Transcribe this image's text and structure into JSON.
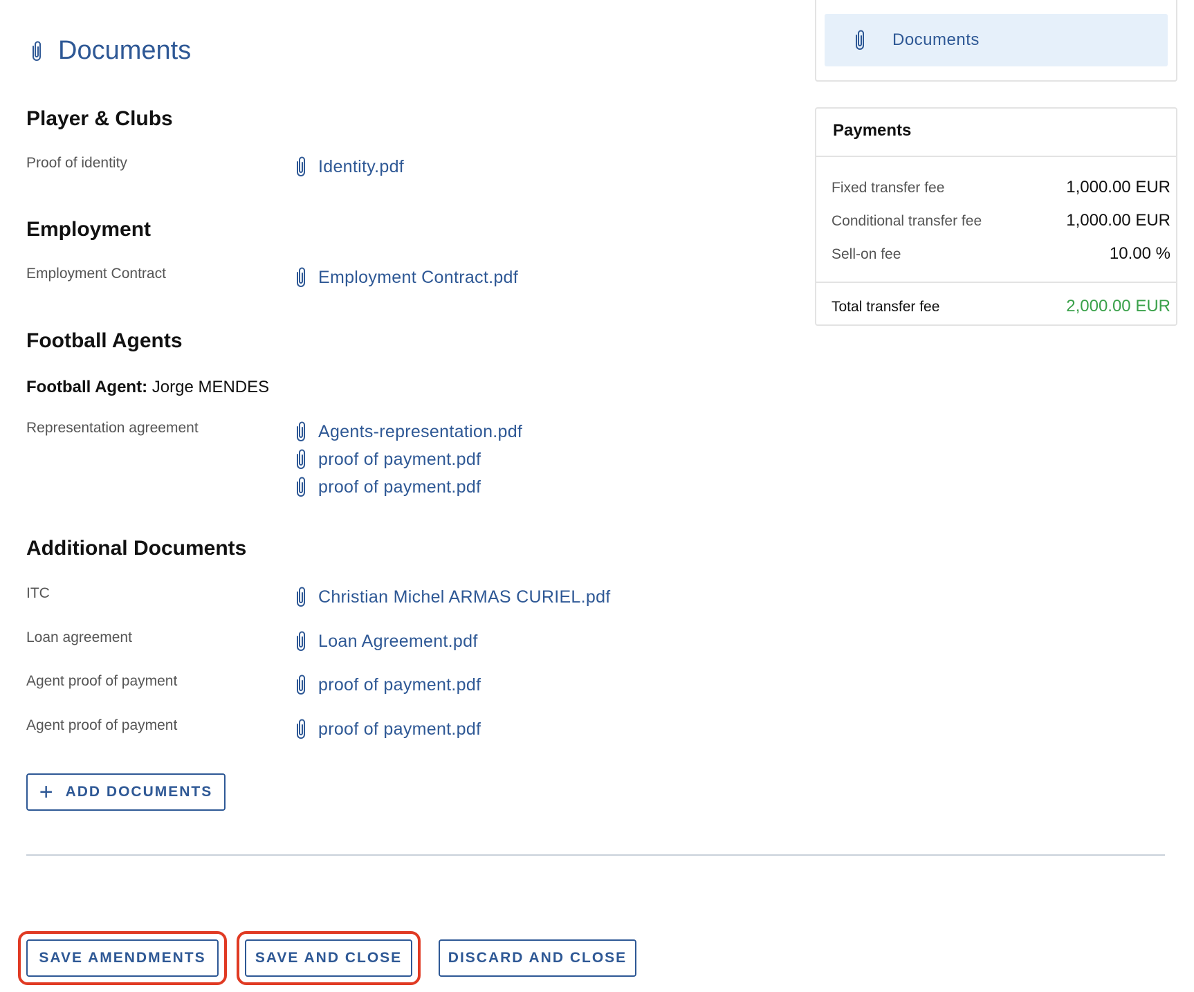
{
  "page": {
    "title": "Documents"
  },
  "sections": {
    "player_clubs": {
      "title": "Player & Clubs",
      "rows": [
        {
          "label": "Proof of identity",
          "files": [
            "Identity.pdf"
          ]
        }
      ]
    },
    "employment": {
      "title": "Employment",
      "rows": [
        {
          "label": "Employment Contract",
          "files": [
            "Employment Contract.pdf"
          ]
        }
      ]
    },
    "football_agents": {
      "title": "Football Agents",
      "agent_label": "Football Agent:",
      "agent_name": "Jorge MENDES",
      "rows": [
        {
          "label": "Representation agreement",
          "files": [
            "Agents-representation.pdf",
            "proof of payment.pdf",
            "proof of payment.pdf"
          ]
        }
      ]
    },
    "additional": {
      "title": "Additional Documents",
      "rows": [
        {
          "label": "ITC",
          "files": [
            "Christian Michel ARMAS CURIEL.pdf"
          ]
        },
        {
          "label": "Loan agreement",
          "files": [
            "Loan Agreement.pdf"
          ]
        },
        {
          "label": "Agent proof of payment",
          "files": [
            "proof of payment.pdf"
          ]
        },
        {
          "label": "Agent proof of payment",
          "files": [
            "proof of payment.pdf"
          ]
        }
      ]
    }
  },
  "buttons": {
    "add_documents": "ADD DOCUMENTS",
    "save_amendments": "SAVE AMENDMENTS",
    "save_and_close": "SAVE AND CLOSE",
    "discard_and_close": "DISCARD AND CLOSE"
  },
  "nav": {
    "documents": "Documents"
  },
  "payments": {
    "title": "Payments",
    "rows": [
      {
        "label": "Fixed transfer fee",
        "value": "1,000.00 EUR"
      },
      {
        "label": "Conditional transfer fee",
        "value": "1,000.00 EUR"
      },
      {
        "label": "Sell-on fee",
        "value": "10.00 %"
      }
    ],
    "total_label": "Total transfer fee",
    "total_value": "2,000.00 EUR"
  },
  "icons": {
    "attachment": "paperclip-icon",
    "add": "plus-icon"
  },
  "colors": {
    "accent": "#2e5895",
    "total": "#3aa14a",
    "highlight": "#e03a23",
    "nav_active_bg": "#e6f0fa"
  }
}
